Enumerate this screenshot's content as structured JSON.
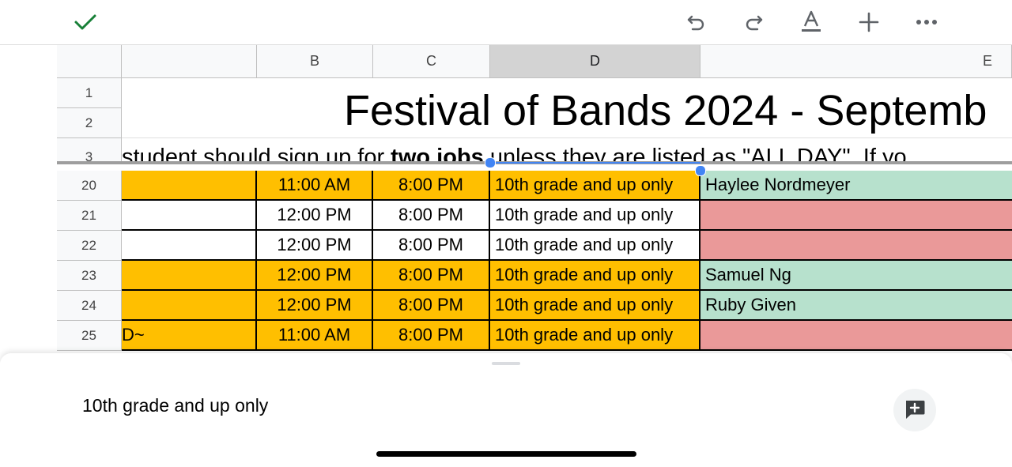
{
  "colors": {
    "accent_green": "#188038",
    "selection_blue": "#4285f4",
    "orange_fill": "#ffbf00",
    "green_fill": "#b7e1cd",
    "red_fill": "#ea9999"
  },
  "toolbar": {
    "icons": [
      "checkmark-icon",
      "undo-icon",
      "redo-icon",
      "text-format-icon",
      "add-icon",
      "more-icon"
    ]
  },
  "sheet": {
    "columns": [
      "",
      "B",
      "C",
      "D",
      "E"
    ],
    "selected_column": "D",
    "title": "Festival of Bands 2024 - Septemb",
    "instruction_part1": "student should sign up for ",
    "instruction_bold": "two jobs",
    "instruction_part2": " unless they are listed as \"ALL DAY\". If yo",
    "rows": [
      {
        "num": "1"
      },
      {
        "num": "2"
      },
      {
        "num": "3"
      },
      {
        "num": "20",
        "a": "",
        "b": "11:00 AM",
        "c": "8:00 PM",
        "d": "10th grade and up only",
        "e": "Haylee Nordmeyer"
      },
      {
        "num": "21",
        "a": "",
        "b": "12:00 PM",
        "c": "8:00 PM",
        "d": "10th grade and up only",
        "e": ""
      },
      {
        "num": "22",
        "a": "",
        "b": "12:00 PM",
        "c": "8:00 PM",
        "d": "10th grade and up only",
        "e": ""
      },
      {
        "num": "23",
        "a": "",
        "b": "12:00 PM",
        "c": "8:00 PM",
        "d": "10th grade and up only",
        "e": "Samuel Ng"
      },
      {
        "num": "24",
        "a": "",
        "b": "12:00 PM",
        "c": "8:00 PM",
        "d": "10th grade and up only",
        "e": "Ruby Given"
      },
      {
        "num": "25",
        "a": "D~",
        "b": "11:00 AM",
        "c": "8:00 PM",
        "d": "10th grade and up only",
        "e": ""
      }
    ]
  },
  "bottom_sheet": {
    "cell_value": "10th grade and up only",
    "comment_icon": "add-comment-icon"
  }
}
